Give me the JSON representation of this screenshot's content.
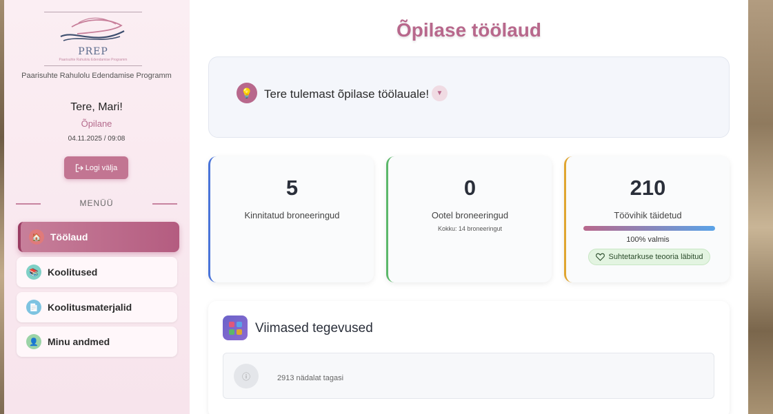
{
  "sidebar": {
    "logo_text": "PREP",
    "logo_subtitle": "Paarisuhte Rahulolu Edendamise Programm",
    "org_name": "Paarisuhte Rahulolu Edendamise Programm",
    "greeting": "Tere, Mari!",
    "role": "Õpilane",
    "datetime": "04.11.2025 / 09:08",
    "logout_label": "Logi välja",
    "menu_heading": "MENÜÜ",
    "items": [
      {
        "label": "Töölaud",
        "icon": "house-icon",
        "active": true
      },
      {
        "label": "Koolitused",
        "icon": "books-icon",
        "active": false
      },
      {
        "label": "Koolitusmaterjalid",
        "icon": "document-icon",
        "active": false
      },
      {
        "label": "Minu andmed",
        "icon": "person-icon",
        "active": false
      }
    ]
  },
  "main": {
    "title": "Õpilase töölaud",
    "welcome_text": "Tere tulemast õpilase töölauale!",
    "stats": [
      {
        "value": "5",
        "label": "Kinnitatud broneeringud",
        "accent": "#4a74d9"
      },
      {
        "value": "0",
        "label": "Ootel broneeringud",
        "sub": "Kokku: 14 broneeringut",
        "accent": "#5cb86a"
      },
      {
        "value": "210",
        "label": "Töövihik täidetud",
        "progress": 1.0,
        "progress_text": "100% valmis",
        "badge": "Suhtetarkuse teooria läbitud",
        "accent": "#e0a530"
      }
    ],
    "activity": {
      "title": "Viimased tegevused",
      "items": [
        {
          "time": "2913 nädalat tagasi",
          "icon": "info-icon"
        }
      ]
    }
  },
  "colors": {
    "brand": "#b8688c",
    "accent_blue": "#4a74d9",
    "accent_green": "#5cb86a",
    "accent_orange": "#e0a530"
  }
}
